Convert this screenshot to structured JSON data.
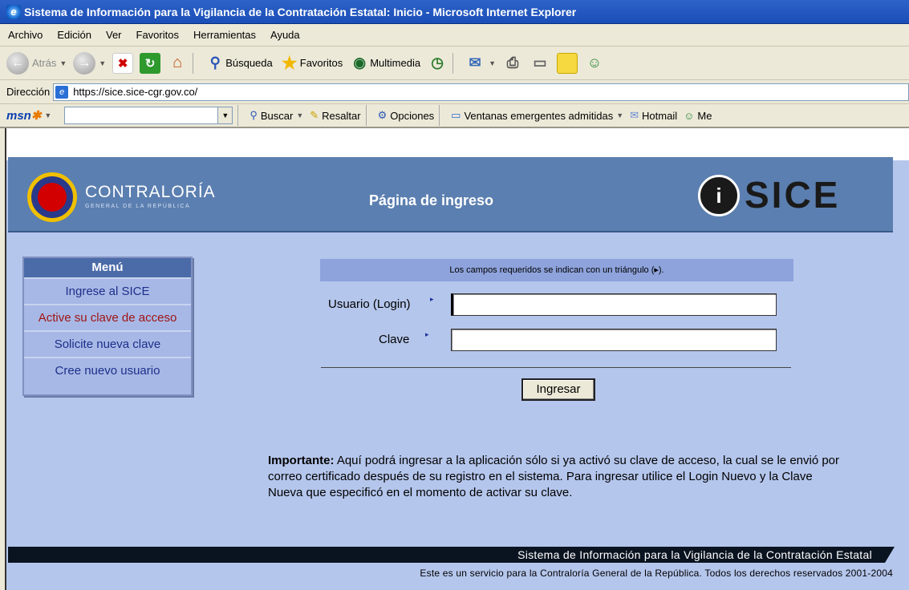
{
  "window": {
    "title": "Sistema de Información para la Vigilancia de la Contratación Estatal: Inicio - Microsoft Internet Explorer"
  },
  "menubar": [
    "Archivo",
    "Edición",
    "Ver",
    "Favoritos",
    "Herramientas",
    "Ayuda"
  ],
  "toolbar": {
    "back_label": "Atrás",
    "search_label": "Búsqueda",
    "favorites_label": "Favoritos",
    "multimedia_label": "Multimedia"
  },
  "address": {
    "label": "Dirección",
    "url": "https://sice.sice-cgr.gov.co/"
  },
  "msnbar": {
    "logo": "msn",
    "search_label": "Buscar",
    "highlight_label": "Resaltar",
    "options_label": "Opciones",
    "popups_label": "Ventanas emergentes admitidas",
    "hotmail_label": "Hotmail",
    "me_label": "Me"
  },
  "header": {
    "org_name": "CONTRALORÍA",
    "org_sub": "GENERAL DE LA REPÚBLICA",
    "page_title": "Página de ingreso",
    "brand_i": "i",
    "brand": "SICE"
  },
  "menu": {
    "title": "Menú",
    "items": [
      "Ingrese al SICE",
      "Active su clave de acceso",
      "Solicite nueva clave",
      "Cree nuevo usuario"
    ]
  },
  "form": {
    "required_note": "Los campos requeridos se indican con un triángulo  (▸).",
    "user_label": "Usuario (Login)",
    "password_label": "Clave",
    "user_value": "",
    "password_value": "",
    "submit_label": "Ingresar"
  },
  "note": {
    "bold": "Importante:",
    "text": " Aquí podrá ingresar a la aplicación sólo si ya activó su clave de acceso, la cual se le envió por correo certificado después de su registro en el sistema. Para ingresar utilice el Login Nuevo y la Clave Nueva que especificó en el momento de activar su clave."
  },
  "footer": {
    "bar": "Sistema de Información para la Vigilancia de la Contratación Estatal",
    "rights": "Este es un servicio para la Contraloría General de la República. Todos los derechos reservados 2001-2004"
  },
  "colors": {
    "page_bg": "#b5c6ec",
    "header_bg": "#5b7fb0",
    "active_menu": "#a01515",
    "link": "#1d2f8a"
  }
}
